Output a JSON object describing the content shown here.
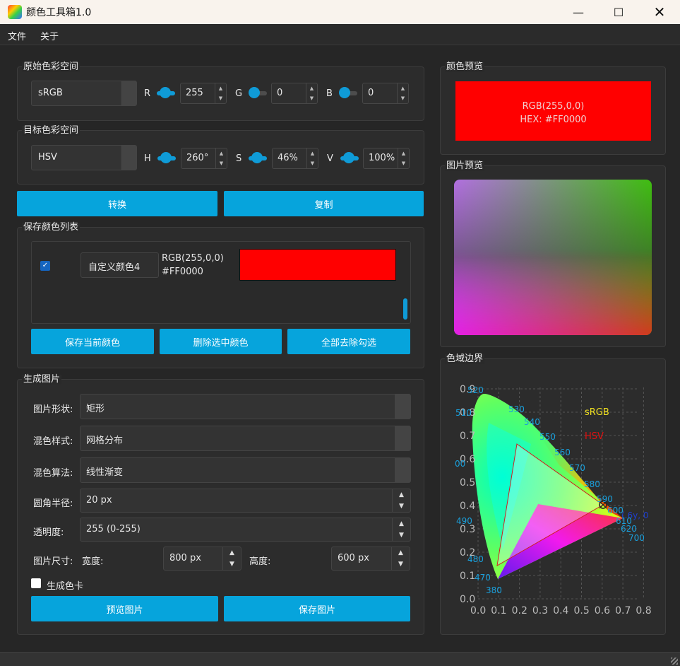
{
  "window": {
    "title": "颜色工具箱1.0"
  },
  "menu": [
    "文件",
    "关于"
  ],
  "source": {
    "group_title": "原始色彩空间",
    "space": "sRGB",
    "channels": [
      {
        "label": "R",
        "value": "255"
      },
      {
        "label": "G",
        "value": "0"
      },
      {
        "label": "B",
        "value": "0"
      }
    ]
  },
  "target": {
    "group_title": "目标色彩空间",
    "space": "HSV",
    "channels": [
      {
        "label": "H",
        "value": "260°"
      },
      {
        "label": "S",
        "value": "46%"
      },
      {
        "label": "V",
        "value": "100%"
      }
    ]
  },
  "actions": {
    "convert": "转换",
    "copy": "复制"
  },
  "saved": {
    "group_title": "保存颜色列表",
    "items": [
      {
        "name": "自定义颜色4",
        "rgb": "RGB(255,0,0)",
        "hex": "#FF0000",
        "checked": true,
        "color": "#ff0000"
      }
    ],
    "save_current": "保存当前颜色",
    "delete_selected": "删除选中颜色",
    "uncheck_all": "全部去除勾选"
  },
  "generate": {
    "group_title": "生成图片",
    "shape_label": "图片形状:",
    "shape_value": "矩形",
    "style_label": "混色样式:",
    "style_value": "网格分布",
    "algo_label": "混色算法:",
    "algo_value": "线性渐变",
    "radius_label": "圆角半径:",
    "radius_value": "20 px",
    "alpha_label": "透明度:",
    "alpha_value": "255 (0-255)",
    "size_label": "图片尺寸:",
    "width_label": "宽度:",
    "width_value": "800 px",
    "height_label": "高度:",
    "height_value": "600 px",
    "card_label": "生成色卡",
    "preview_btn": "预览图片",
    "save_btn": "保存图片"
  },
  "color_preview": {
    "group_title": "颜色预览",
    "rgb": "RGB(255,0,0)",
    "hex": "HEX: #FF0000",
    "color": "#ff0000"
  },
  "image_preview": {
    "group_title": "图片预览"
  },
  "gamut": {
    "group_title": "色域边界",
    "legend_srgb": "sRGB",
    "legend_hsv": "HSV",
    "legend_srgb_color": "#f0e020",
    "legend_hsv_color": "#e01010",
    "y_ticks": [
      "0.0",
      "0.1",
      "0.2",
      "0.3",
      "0.4",
      "0.5",
      "0.6",
      "0.7",
      "0.8",
      "0.9"
    ],
    "x_ticks": [
      "0.0",
      "0.1",
      "0.2",
      "0.3",
      "0.4",
      "0.5",
      "0.6",
      "0.7",
      "0.8"
    ],
    "wavelengths": [
      "380",
      "470",
      "480",
      "490",
      "00",
      "510",
      "520",
      "530",
      "540",
      "550",
      "560",
      "570",
      "580",
      "590",
      "600",
      "610",
      "620",
      "700"
    ],
    "point_label": "(.6y, 0"
  }
}
